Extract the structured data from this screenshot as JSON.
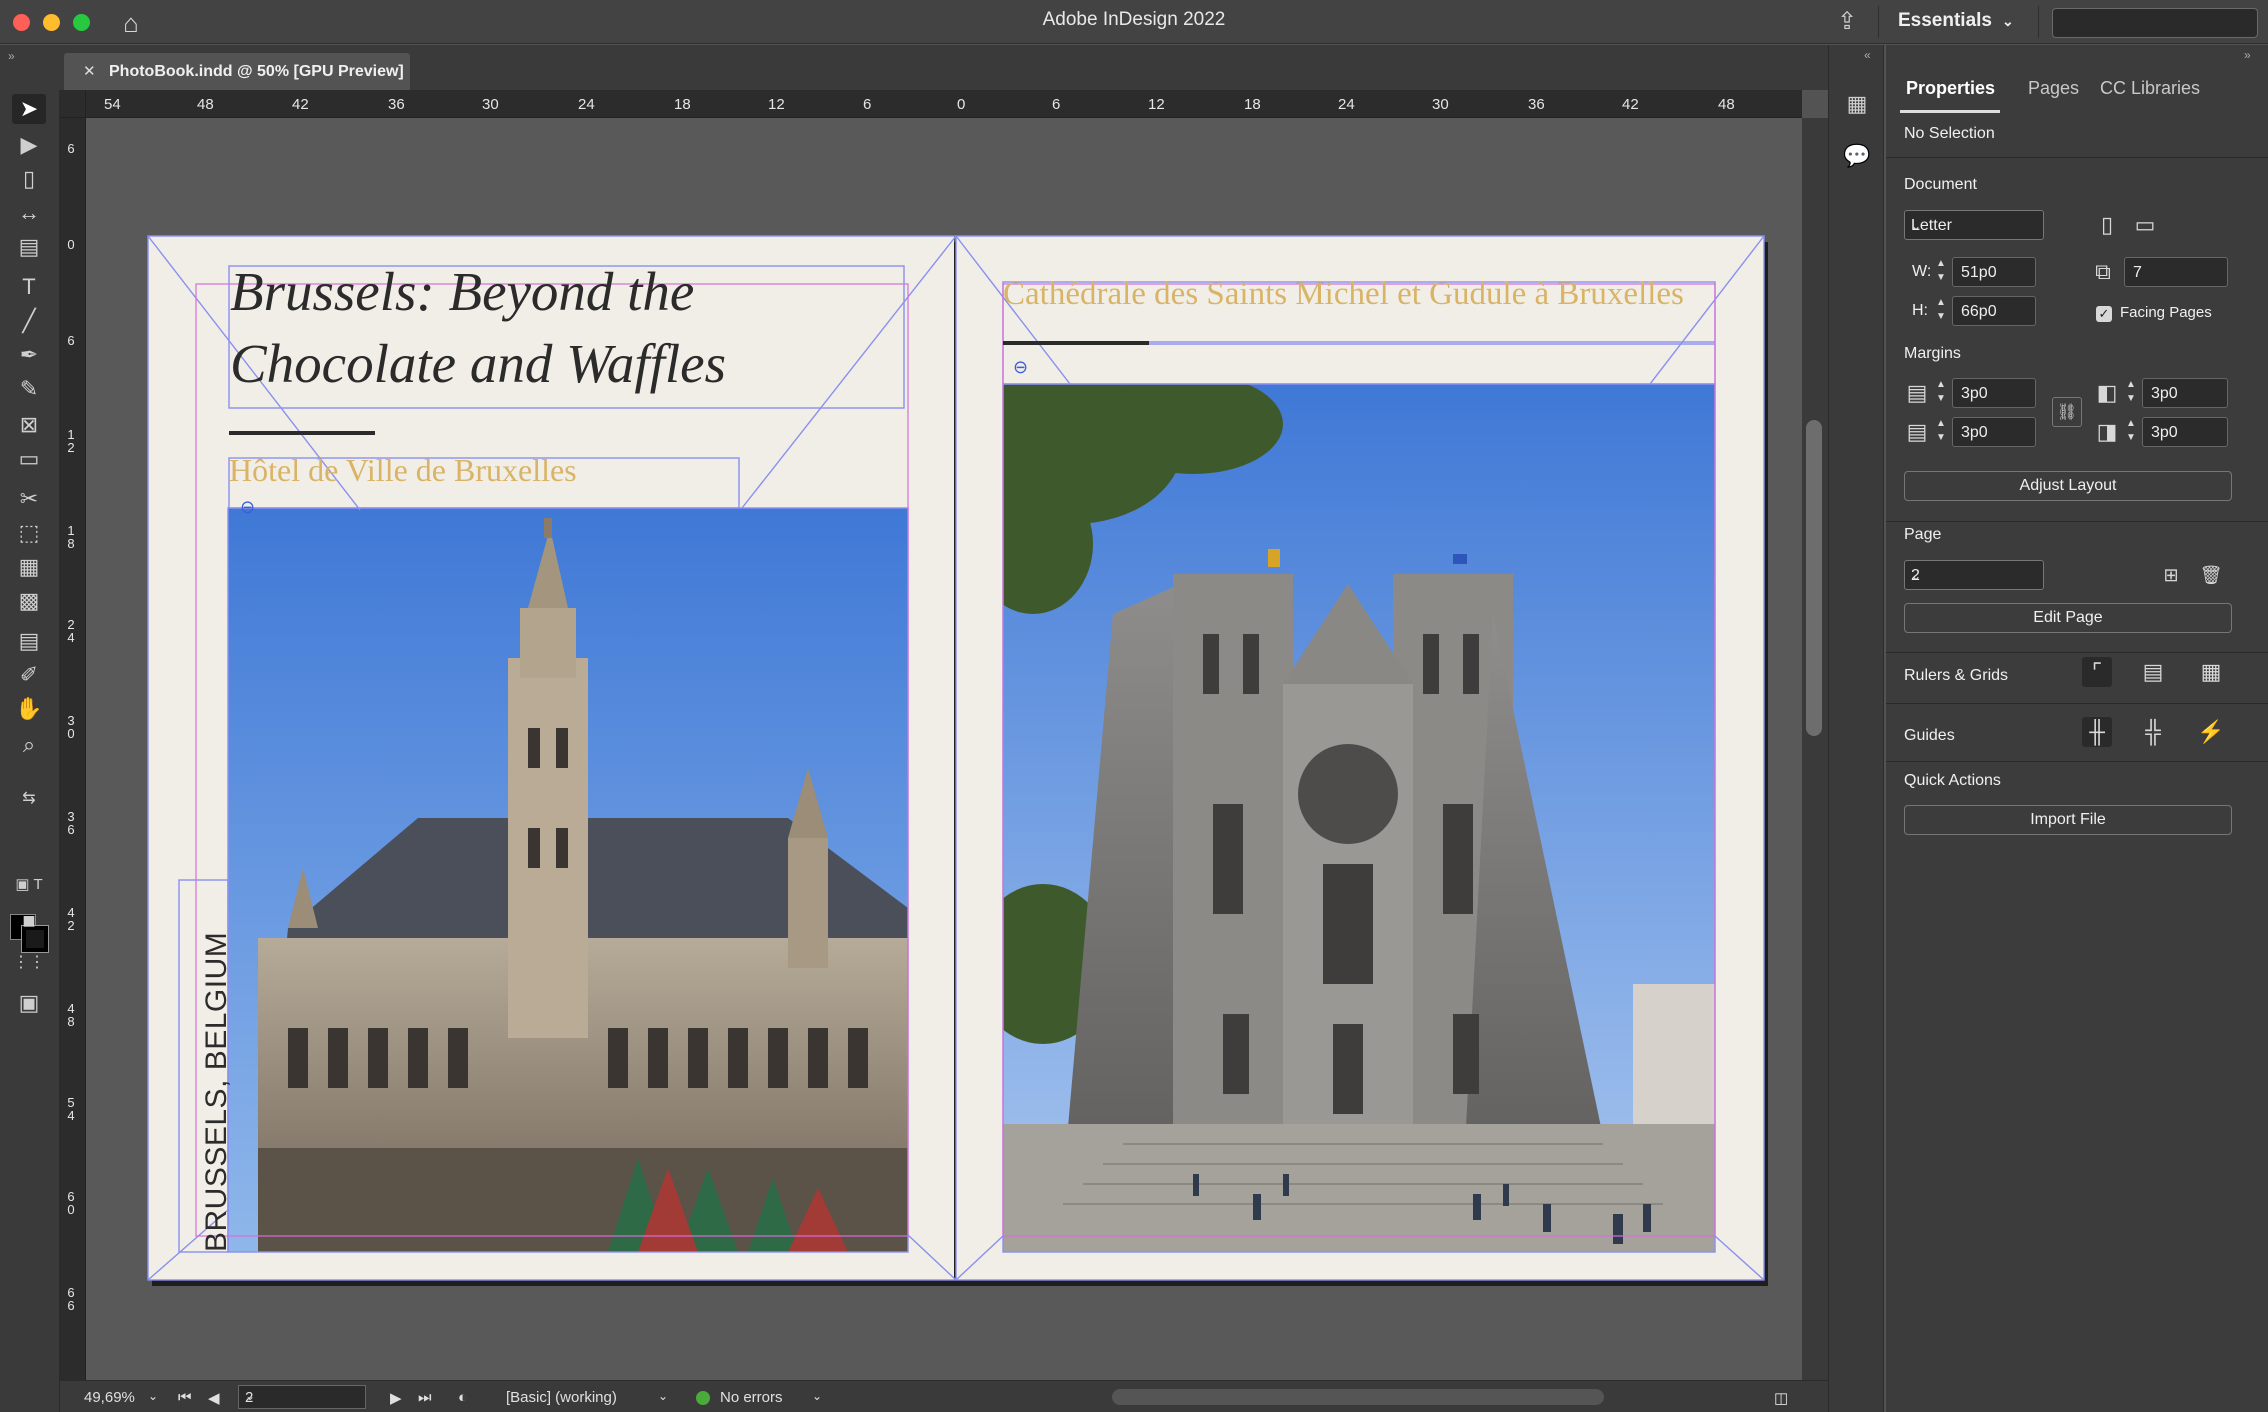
{
  "window": {
    "title": "Adobe InDesign 2022",
    "workspace": "Essentials"
  },
  "document_tab": {
    "name": "PhotoBook.indd @ 50% [GPU Preview]"
  },
  "rulers": {
    "horizontal": [
      "54",
      "48",
      "42",
      "36",
      "30",
      "24",
      "18",
      "12",
      "6",
      "0",
      "6",
      "12",
      "18",
      "24",
      "30",
      "36",
      "42",
      "48"
    ],
    "vertical": [
      "6",
      "0",
      "6",
      "1 2",
      "1 8",
      "2 4",
      "3 0",
      "3 6",
      "4 2",
      "4 8",
      "5 4",
      "6 0",
      "6 6"
    ]
  },
  "spread": {
    "left_page": {
      "headline": "Brussels: Beyond the Chocolate and Waffles",
      "subheading": "Hôtel de Ville de Bruxelles",
      "vertical_caption": "BRUSSELS, BELGIUM",
      "photo": "Hôtel de Ville de Bruxelles"
    },
    "right_page": {
      "subheading": "Cathédrale des Saints Michel et Gudule à Bruxelles",
      "photo": "Cathédrale des Saints Michel et Gudule"
    }
  },
  "status_bar": {
    "zoom": "49,69%",
    "page": "2",
    "preflight_profile": "[Basic] (working)",
    "errors": "No errors"
  },
  "properties_panel": {
    "tabs": [
      "Properties",
      "Pages",
      "CC Libraries"
    ],
    "selection": "No Selection",
    "document_label": "Document",
    "page_size": "Letter",
    "width_label": "W:",
    "width": "51p0",
    "height_label": "H:",
    "height": "66p0",
    "pages_count": "7",
    "facing_pages_label": "Facing Pages",
    "facing_pages_checked": true,
    "margins_label": "Margins",
    "margin_top": "3p0",
    "margin_bottom": "3p0",
    "margin_inside": "3p0",
    "margin_outside": "3p0",
    "adjust_layout": "Adjust Layout",
    "page_label": "Page",
    "page_value": "2",
    "edit_page": "Edit Page",
    "rulers_grids_label": "Rulers & Grids",
    "guides_label": "Guides",
    "quick_actions_label": "Quick Actions",
    "import_file": "Import File"
  },
  "colors": {
    "page": "#f1eee7",
    "gold_text": "#d9b467",
    "frame_edge": "#8a90ef",
    "margin_guide": "#d66fd6",
    "sky": "#4f86d6"
  }
}
